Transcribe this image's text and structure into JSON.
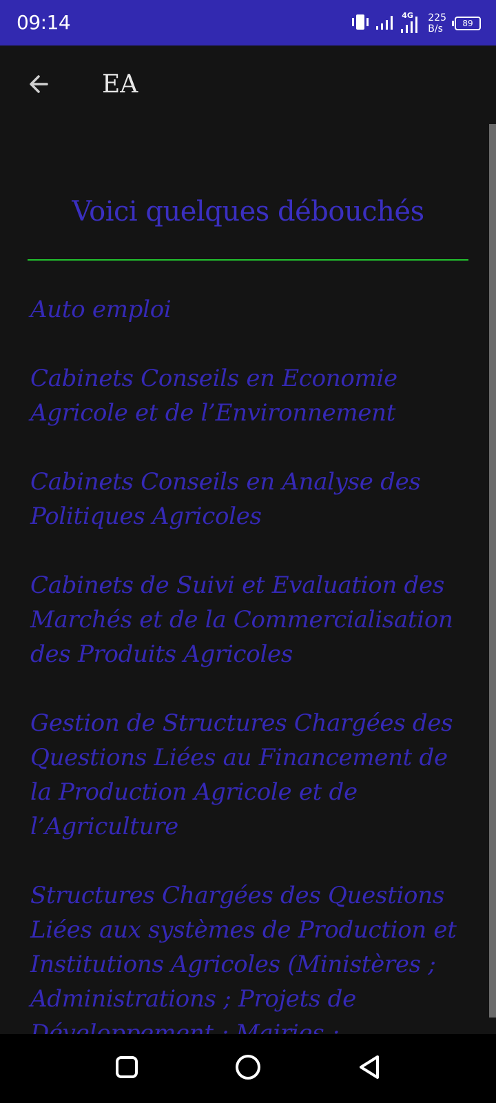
{
  "status_bar": {
    "time": "09:14",
    "network": "4G",
    "speed_value": "225",
    "speed_unit": "B/s",
    "battery": "89",
    "icons": [
      "vibrate-icon",
      "signal-icon",
      "signal-4g-icon",
      "battery-icon"
    ]
  },
  "app_bar": {
    "title": "EA",
    "back_icon": "arrow-back-icon"
  },
  "content": {
    "heading": "Voici quelques débouchés",
    "items": [
      "Auto emploi",
      "Cabinets Conseils en Economie Agricole et de l’Environnement",
      "Cabinets Conseils en Analyse des Politiques Agricoles",
      "Cabinets de Suivi et Evaluation des Marchés et de la Commercialisation des Produits Agricoles",
      "Gestion de Structures Chargées des Questions Liées au Financement de la Production Agricole et de l’Agriculture",
      "Structures Chargées des Questions Liées aux systèmes de Production et Institutions Agricoles (Ministères ; Administrations ; Projets de Développement ; Mairies ; Entreprises de tous Genres)"
    ]
  },
  "nav_bar": {
    "icons": [
      "recent-apps-icon",
      "home-icon",
      "back-triangle-icon"
    ]
  },
  "colors": {
    "status_bar": "#3229b0",
    "background": "#141414",
    "heading": "#3a2fc0",
    "item_text": "#3529b6",
    "divider": "#22c22e",
    "nav_bar": "#000000"
  }
}
